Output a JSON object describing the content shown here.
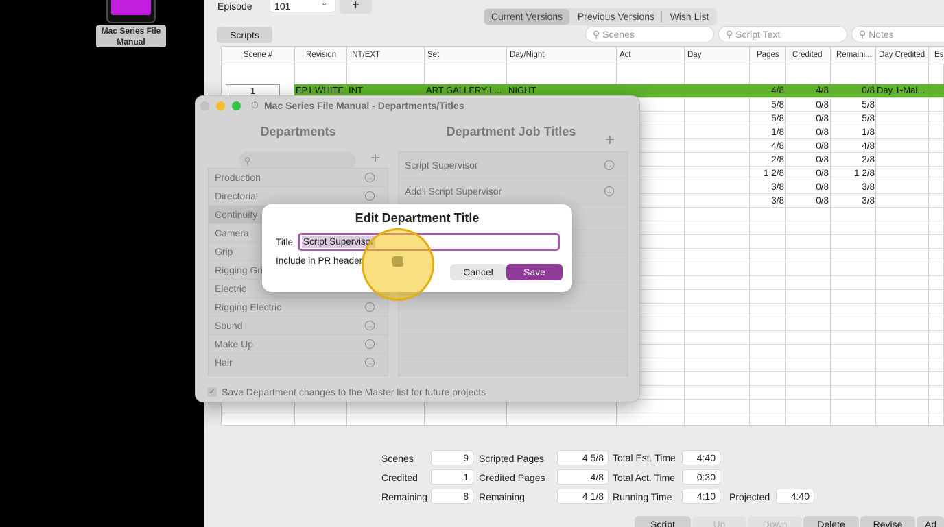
{
  "desktop": {
    "icon_label": "Mac Series File Manual",
    "icon_color": "#c21ee0"
  },
  "main": {
    "episode_label": "Episode",
    "episode_value": "101",
    "add_symbol": "+",
    "version_tabs": [
      "Current Versions",
      "Previous Versions",
      "Wish List"
    ],
    "scripts_button": "Scripts",
    "search": {
      "scenes": "Scenes",
      "script_text": "Script Text",
      "notes": "Notes"
    },
    "columns": [
      "Scene #",
      "Revision",
      "INT/EXT",
      "Set",
      "Day/Night",
      "Act",
      "Day",
      "Pages",
      "Credited",
      "Remaini...",
      "Day Credited",
      "Es"
    ],
    "selected_row": {
      "scene": "1",
      "revision": "EP1 WHITE",
      "int_ext": "INT",
      "set": "ART GALLERY L...",
      "day_night": "NIGHT",
      "pages": "4/8",
      "credited": "4/8",
      "remaining": "0/8",
      "day_credited": "Day 1-Mai..."
    },
    "rows": [
      {
        "pages": "5/8",
        "credited": "0/8",
        "remaining": "5/8"
      },
      {
        "pages": "5/8",
        "credited": "0/8",
        "remaining": "5/8"
      },
      {
        "pages": "1/8",
        "credited": "0/8",
        "remaining": "1/8"
      },
      {
        "pages": "4/8",
        "credited": "0/8",
        "remaining": "4/8"
      },
      {
        "pages": "2/8",
        "credited": "0/8",
        "remaining": "2/8"
      },
      {
        "pages": "1 2/8",
        "credited": "0/8",
        "remaining": "1 2/8"
      },
      {
        "pages": "3/8",
        "credited": "0/8",
        "remaining": "3/8"
      },
      {
        "pages": "3/8",
        "credited": "0/8",
        "remaining": "3/8"
      }
    ],
    "selected_row_color": "#5fb32b",
    "stats": {
      "scenes_label": "Scenes",
      "scenes": "9",
      "credited_label": "Credited",
      "credited": "1",
      "remaining_label": "Remaining",
      "remaining": "8",
      "scripted_pages_label": "Scripted Pages",
      "scripted_pages": "4 5/8",
      "credited_pages_label": "Credited Pages",
      "credited_pages": "4/8",
      "remaining_pages_label": "Remaining",
      "remaining_pages": "4 1/8",
      "total_est_label": "Total Est. Time",
      "total_est": "4:40",
      "total_act_label": "Total Act. Time",
      "total_act": "0:30",
      "running_label": "Running Time",
      "running": "4:10",
      "projected_label": "Projected",
      "projected": "4:40"
    },
    "bottom_buttons": [
      "Script",
      "Up",
      "Down",
      "Delete",
      "Revise",
      "Ad"
    ]
  },
  "dept_window": {
    "title": "Mac Series File Manual - Departments/Titles",
    "departments_heading": "Departments",
    "job_titles_heading": "Department Job Titles",
    "add_symbol": "+",
    "departments": [
      "Production",
      "Directorial",
      "Continuity",
      "Camera",
      "Grip",
      "Rigging Grip",
      "Electric",
      "Rigging Electric",
      "Sound",
      "Make Up",
      "Hair"
    ],
    "job_titles": [
      "Script Supervisor",
      "Add'l Script Supervisor"
    ],
    "save_master_label": "Save Department changes to the Master list for future projects"
  },
  "edit_sheet": {
    "heading": "Edit Department Title",
    "title_label": "Title",
    "title_value": "Script Supervisor",
    "include_label": "Include in PR header",
    "cancel_label": "Cancel",
    "save_label": "Save",
    "accent_color": "#8e3a96",
    "highlight_color": "#f5c518"
  }
}
